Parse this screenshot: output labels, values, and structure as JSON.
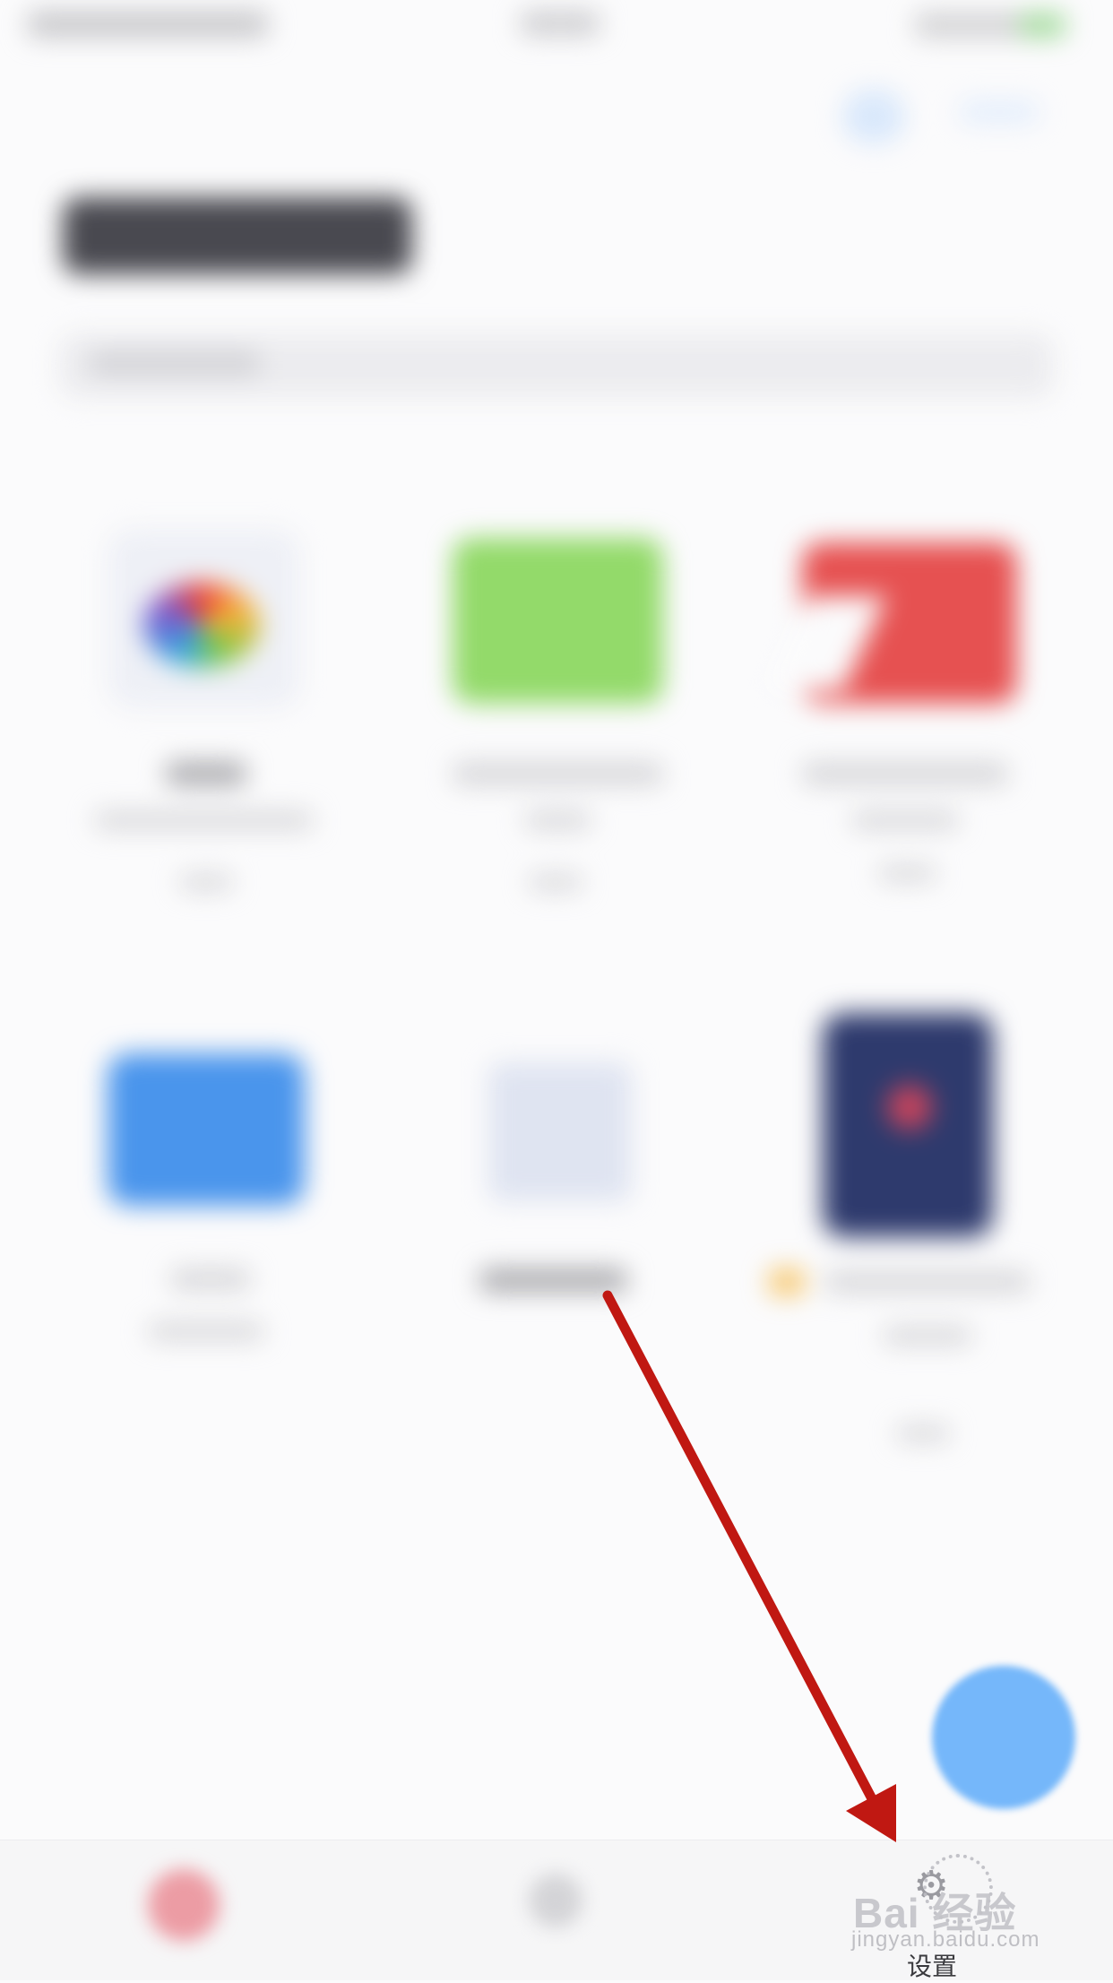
{
  "tab_bar": {
    "settings_label": "设置",
    "settings_icon": "gear-icon"
  },
  "watermark": {
    "logo_text": "Bai 经验",
    "url_text": "jingyan.baidu.com"
  },
  "colors": {
    "annotation_arrow": "#c01812",
    "fab": "#75b7fa",
    "green_folder": "#93da6a",
    "red_folder": "#e65151",
    "blue_folder": "#4a95ec",
    "phone_tile": "#2e3a6d"
  }
}
